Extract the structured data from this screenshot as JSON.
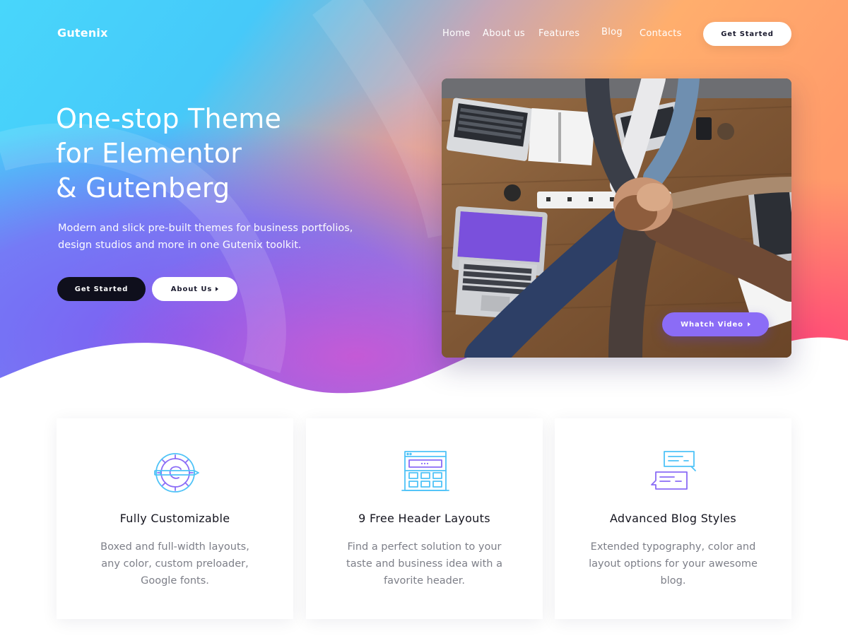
{
  "header": {
    "logo": "Gutenix",
    "nav": [
      {
        "label": "Home"
      },
      {
        "label": "About us"
      },
      {
        "label": "Features"
      },
      {
        "label": "Blog"
      },
      {
        "label": "Contacts"
      }
    ],
    "cta_label": "Get Started"
  },
  "hero": {
    "title_lines": [
      "One-stop Theme",
      "for Elementor",
      "& Gutenberg"
    ],
    "subtitle_lines": [
      "Modern and slick pre-built themes for business portfolios,",
      "design studios and more in one Gutenix toolkit."
    ],
    "primary_button": "Get Started",
    "secondary_button": "About Us",
    "video_button": "Whatch Video"
  },
  "features": [
    {
      "icon": "gear-pencil-icon",
      "title": "Fully Customizable",
      "desc_lines": [
        "Boxed and full-width layouts,",
        "any color, custom preloader,",
        "Google fonts."
      ]
    },
    {
      "icon": "browser-layout-icon",
      "title": "9 Free Header Layouts",
      "desc_lines": [
        "Find a perfect solution to your",
        "taste and business idea with a",
        "favorite header."
      ]
    },
    {
      "icon": "chat-bubbles-icon",
      "title": "Advanced Blog Styles",
      "desc_lines": [
        "Extended typography, color and",
        "layout options for your awesome",
        "blog."
      ]
    }
  ],
  "colors": {
    "hero_cyan": "#3fd0f8",
    "hero_blue": "#5b8cf5",
    "hero_purple": "#7c5cf2",
    "hero_orange": "#ffb06a",
    "hero_pink": "#ff5e7a",
    "button_dark": "#0f0f1c",
    "video_button": "#8b6cf6",
    "icon_stroke_blue": "#4fc3f7",
    "icon_stroke_purple": "#8b6cf6"
  }
}
